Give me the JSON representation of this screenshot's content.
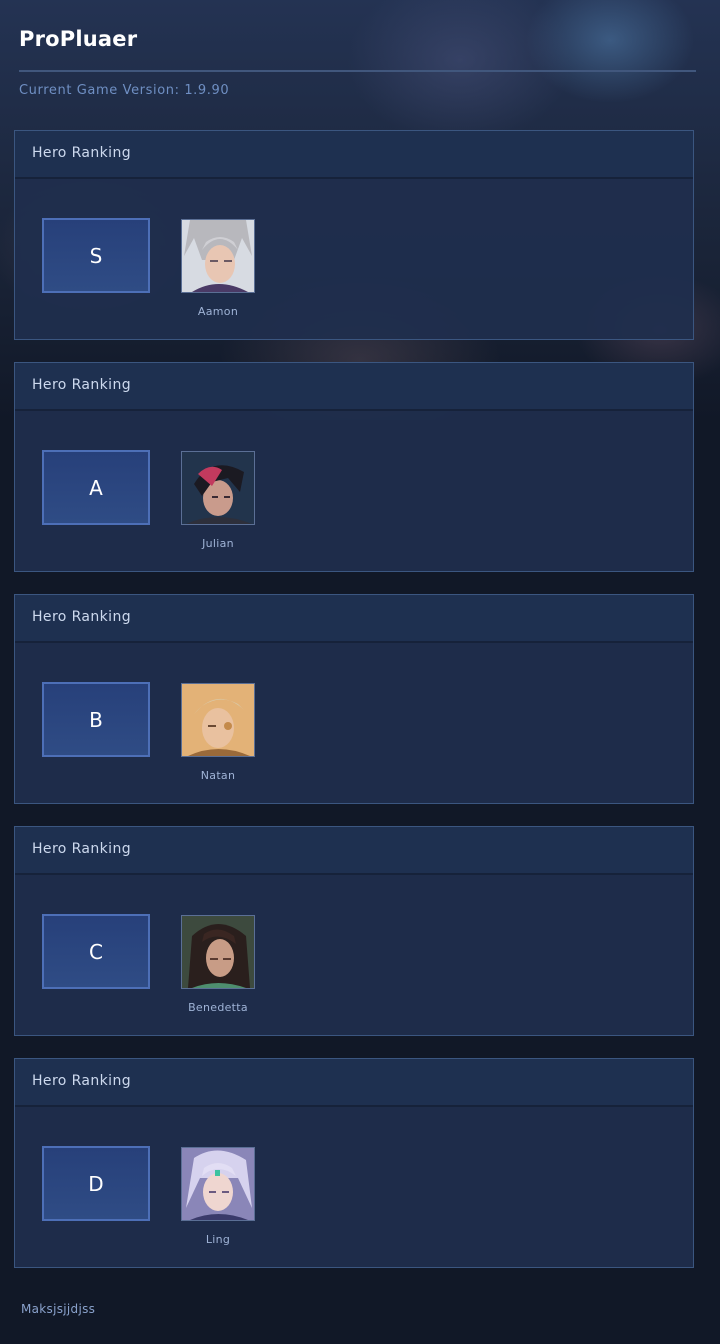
{
  "app": {
    "title": "ProPluaer",
    "version_label": "Current Game Version:",
    "version_value": "1.9.90"
  },
  "tiers": [
    {
      "heading": "Hero Ranking",
      "tier": "S",
      "hero": "Aamon",
      "portrait_icon": "aamon-portrait-icon",
      "accent": "#c9c6c4"
    },
    {
      "heading": "Hero Ranking",
      "tier": "A",
      "hero": "Julian",
      "portrait_icon": "julian-portrait-icon",
      "accent": "#b03a5a"
    },
    {
      "heading": "Hero Ranking",
      "tier": "B",
      "hero": "Natan",
      "portrait_icon": "natan-portrait-icon",
      "accent": "#d7a061"
    },
    {
      "heading": "Hero Ranking",
      "tier": "C",
      "hero": "Benedetta",
      "portrait_icon": "benedetta-portrait-icon",
      "accent": "#3b2a28"
    },
    {
      "heading": "Hero Ranking",
      "tier": "D",
      "hero": "Ling",
      "portrait_icon": "ling-portrait-icon",
      "accent": "#b7b3dc"
    }
  ],
  "footer": {
    "text": "Maksjsjjdjss"
  },
  "colors": {
    "page_bg": "#111827",
    "panel_bg": "#1f2e4e",
    "panel_border": "#3b5680",
    "tier_border": "#4d6fb7",
    "version_text": "#6f8fc3"
  }
}
